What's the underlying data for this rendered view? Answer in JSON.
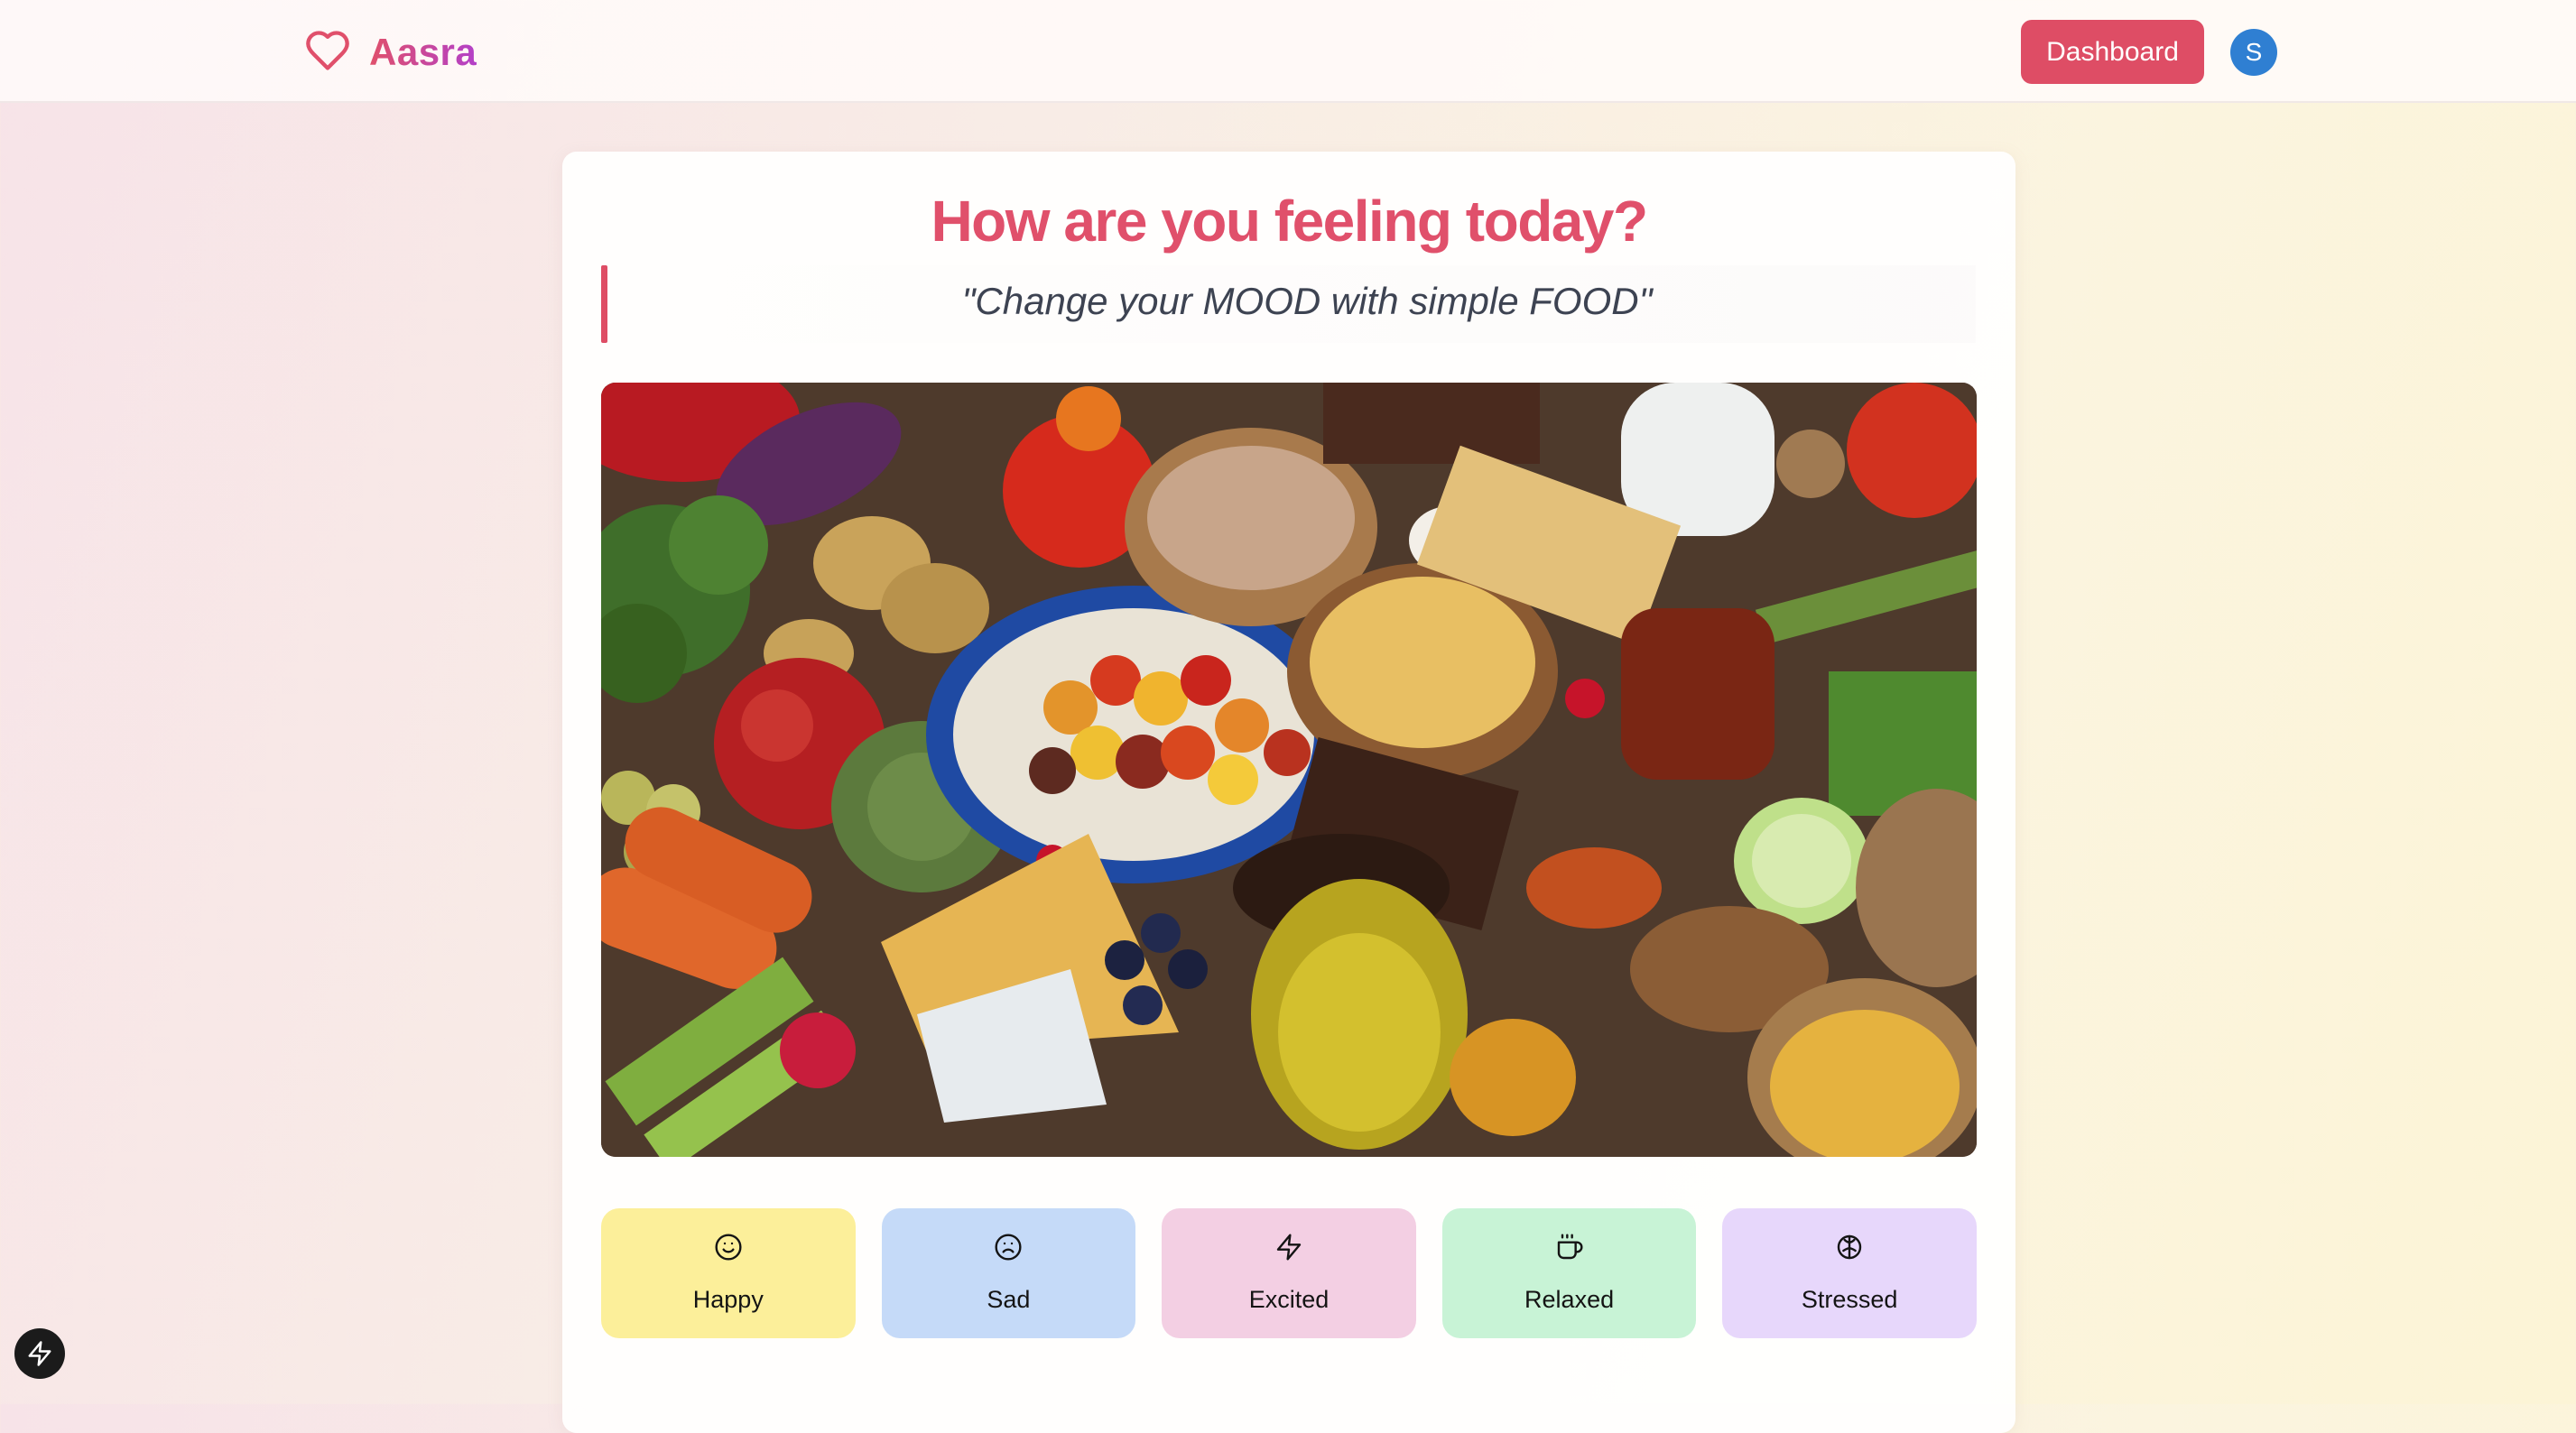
{
  "header": {
    "brand_name": "Aasra",
    "brand_icon": "heart-icon",
    "dashboard_label": "Dashboard",
    "avatar_initial": "S"
  },
  "main": {
    "title": "How are you feeling today?",
    "quote": "\"Change your MOOD with simple FOOD\"",
    "hero_image": "food-assortment-image"
  },
  "moods": [
    {
      "label": "Happy",
      "icon": "smile-icon",
      "color": "#fcef9a"
    },
    {
      "label": "Sad",
      "icon": "frown-icon",
      "color": "#c5daf8"
    },
    {
      "label": "Excited",
      "icon": "zap-icon",
      "color": "#f3cfe3"
    },
    {
      "label": "Relaxed",
      "icon": "coffee-icon",
      "color": "#c8f3d6"
    },
    {
      "label": "Stressed",
      "icon": "brain-icon",
      "color": "#e7d7fb"
    }
  ],
  "colors": {
    "accent": "#de4d65",
    "title": "#e0506b",
    "avatar": "#2f7fd2"
  },
  "dev_badge_icon": "bolt-icon"
}
